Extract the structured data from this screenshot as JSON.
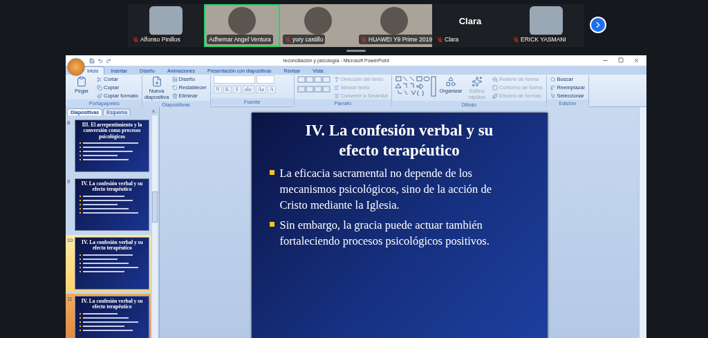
{
  "participants": [
    {
      "name": "Alfonso Pinillos",
      "kind": "thumb",
      "speaking": false,
      "muted": true
    },
    {
      "name": "Adhemar Angel Ventura",
      "kind": "video",
      "speaking": true,
      "muted": false
    },
    {
      "name": "yury castillo",
      "kind": "video",
      "speaking": false,
      "muted": true
    },
    {
      "name": "HUAWEI Y9 Prime 2019",
      "kind": "video",
      "speaking": false,
      "muted": true
    },
    {
      "name": "Clara",
      "display_name": "Clara",
      "kind": "name",
      "speaking": false,
      "muted": true
    },
    {
      "name": "ERICK YASMANI",
      "kind": "thumb",
      "speaking": false,
      "muted": true
    }
  ],
  "window": {
    "title": "reconciliación y psicología - Microsoft PowerPoint"
  },
  "ribbon": {
    "tabs": [
      {
        "label": "Inicio",
        "selected": true
      },
      {
        "label": "Insertar",
        "selected": false
      },
      {
        "label": "Diseño",
        "selected": false
      },
      {
        "label": "Animaciones",
        "selected": false
      },
      {
        "label": "Presentación con diapositivas",
        "selected": false
      },
      {
        "label": "Revisar",
        "selected": false
      },
      {
        "label": "Vista",
        "selected": false
      }
    ],
    "groups": [
      {
        "label": "Portapapeles",
        "items": [
          {
            "kind": "large",
            "label": "Pegar",
            "disabled": false
          },
          {
            "kind": "small",
            "label": "Cortar",
            "disabled": false
          },
          {
            "kind": "small",
            "label": "Copiar",
            "disabled": false
          },
          {
            "kind": "small",
            "label": "Copiar formato",
            "disabled": false
          }
        ]
      },
      {
        "label": "Diapositivas",
        "items": [
          {
            "kind": "large",
            "label": "Nueva diapositiva",
            "disabled": false
          },
          {
            "kind": "small",
            "label": "Diseño",
            "disabled": false
          },
          {
            "kind": "small",
            "label": "Restablecer",
            "disabled": false
          },
          {
            "kind": "small",
            "label": "Eliminar",
            "disabled": false
          }
        ]
      },
      {
        "label": "Fuente",
        "items": [
          {
            "kind": "format",
            "label": "N",
            "disabled": true
          },
          {
            "kind": "format",
            "label": "K",
            "disabled": true
          },
          {
            "kind": "format",
            "label": "S",
            "disabled": true
          },
          {
            "kind": "format",
            "label": "abc",
            "disabled": true
          },
          {
            "kind": "format",
            "label": "Aa",
            "disabled": true
          },
          {
            "kind": "format",
            "label": "A",
            "disabled": true
          }
        ]
      },
      {
        "label": "Párrafo",
        "items": [
          {
            "kind": "small",
            "label": "Dirección del texto",
            "disabled": true
          },
          {
            "kind": "small",
            "label": "Alinear texto",
            "disabled": true
          },
          {
            "kind": "small",
            "label": "Convertir a SmartArt",
            "disabled": true
          }
        ]
      },
      {
        "label": "Dibujo",
        "items": [
          {
            "kind": "large",
            "label": "Organizar",
            "disabled": false
          },
          {
            "kind": "large",
            "label": "Estilos rápidos",
            "disabled": true
          },
          {
            "kind": "small",
            "label": "Relleno de forma",
            "disabled": true
          },
          {
            "kind": "small",
            "label": "Contorno de forma",
            "disabled": true
          },
          {
            "kind": "small",
            "label": "Efectos de formas",
            "disabled": true
          }
        ]
      },
      {
        "label": "Edición",
        "items": [
          {
            "kind": "small",
            "label": "Buscar",
            "disabled": false
          },
          {
            "kind": "small",
            "label": "Reemplazar",
            "disabled": false
          },
          {
            "kind": "small",
            "label": "Seleccionar",
            "disabled": false
          }
        ]
      }
    ]
  },
  "pane": {
    "tabs": [
      {
        "label": "Diapositivas",
        "selected": true
      },
      {
        "label": "Esquema",
        "selected": false
      }
    ],
    "slides": [
      {
        "number": "8",
        "selected": false,
        "hovered": false,
        "title": "III. El arrepentimiento y la conversión como procesos psicológicos"
      },
      {
        "number": "9",
        "selected": false,
        "hovered": false,
        "title": "IV. La confesión verbal y su efecto terapéutico"
      },
      {
        "number": "10",
        "selected": false,
        "hovered": true,
        "title": "IV. La confesión verbal y su efecto terapéutico"
      },
      {
        "number": "11",
        "selected": true,
        "hovered": false,
        "title": "IV. La confesión verbal y su efecto terapéutico"
      }
    ]
  },
  "slide": {
    "title": "IV. La confesión verbal y su efecto terapéutico",
    "bullets": [
      "La eficacia sacramental no depende de los mecanismos psicológicos, sino de la acción de Cristo mediante la Iglesia.",
      "Sin embargo, la gracia puede actuar también fortaleciendo procesos psicológicos positivos."
    ]
  }
}
